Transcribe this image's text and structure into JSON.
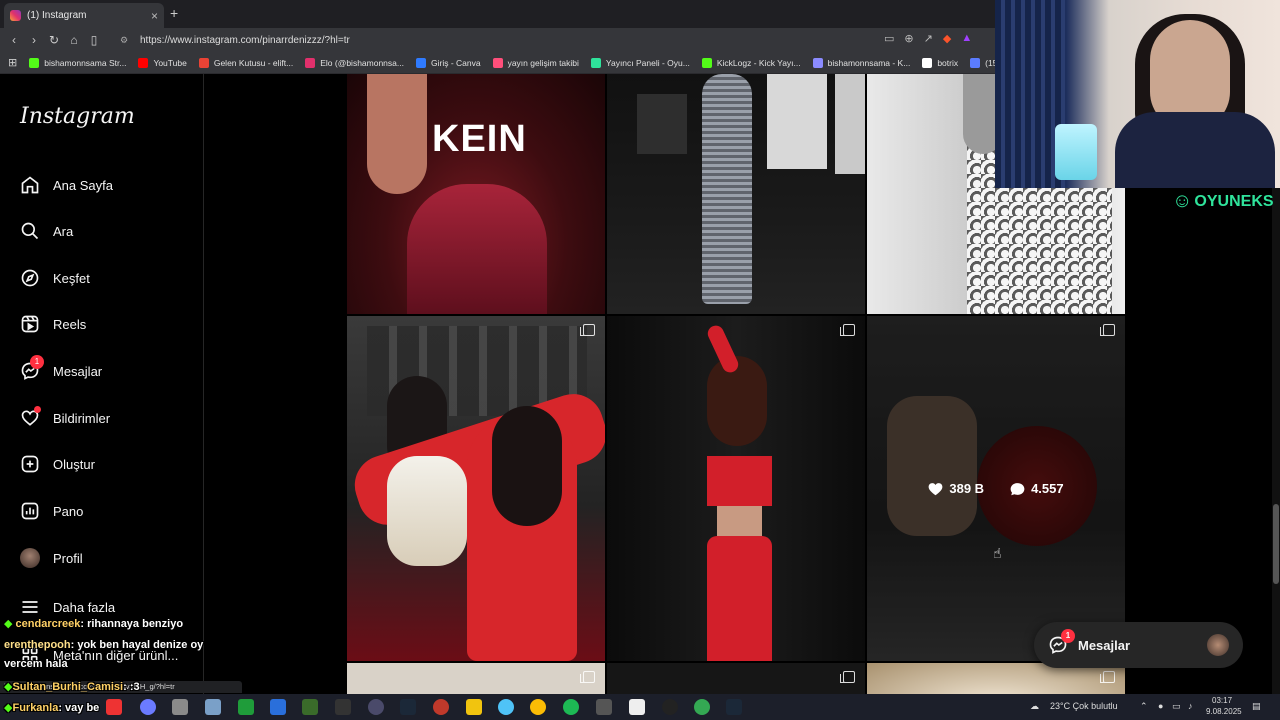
{
  "browser": {
    "tab_title": "(1) Instagram",
    "url": "https://www.instagram.com/pinarrdenizzz/?hl=tr",
    "bookmarks": [
      {
        "label": "bishamonnsama Str...",
        "color": "#53fc18"
      },
      {
        "label": "YouTube",
        "color": "#ff0000"
      },
      {
        "label": "Gelen Kutusu - elift...",
        "color": "#ea4335"
      },
      {
        "label": "Elo (@bishamonnsa...",
        "color": "#e1306c"
      },
      {
        "label": "Giriş - Canva",
        "color": "#2f7bff"
      },
      {
        "label": "yayın gelişim takibi",
        "color": "#ff4f7b"
      },
      {
        "label": "Yayıncı Paneli - Oyu...",
        "color": "#2fe39b"
      },
      {
        "label": "KickLogz - Kick Yayı...",
        "color": "#53fc18"
      },
      {
        "label": "bishamonnsama - K...",
        "color": "#8b8bff"
      },
      {
        "label": "botrix",
        "color": "#ffffff"
      },
      {
        "label": "(15) Dashboard /",
        "color": "#5b7cff"
      }
    ]
  },
  "sidebar": {
    "logo": "Instagram",
    "items": [
      {
        "label": "Ana Sayfa",
        "icon": "home-icon"
      },
      {
        "label": "Ara",
        "icon": "search-icon"
      },
      {
        "label": "Keşfet",
        "icon": "compass-icon"
      },
      {
        "label": "Reels",
        "icon": "reels-icon"
      },
      {
        "label": "Mesajlar",
        "icon": "messenger-icon",
        "badge": "1"
      },
      {
        "label": "Bildirimler",
        "icon": "heart-icon"
      },
      {
        "label": "Oluştur",
        "icon": "plus-square-icon"
      },
      {
        "label": "Pano",
        "icon": "dashboard-icon"
      },
      {
        "label": "Profil",
        "icon": "avatar"
      },
      {
        "label": "Daha fazla",
        "icon": "menu-icon"
      },
      {
        "label": "Meta'nın diğer ürünl...",
        "icon": "meta-icon"
      }
    ]
  },
  "feed": {
    "posts": [
      {
        "caption_text": "KEIN"
      },
      {},
      {},
      {},
      {},
      {
        "likes": "389 B",
        "comments": "4.557"
      }
    ]
  },
  "messages_pill": {
    "label": "Mesajlar",
    "badge": "1"
  },
  "overlay": {
    "brand": "OYUNEKS",
    "chat": [
      {
        "user": "cendarcreek",
        "text": ": rihannaya benziyo"
      },
      {
        "user": "erenthepooh",
        "text": ": yok ben hayal denize oy"
      },
      {
        "user": "",
        "text": "vercem hala"
      },
      {
        "user": "Sultan_Burhi_Camisi",
        "text": ": :3"
      },
      {
        "user": "Furkanla",
        "text": ": vay be"
      }
    ],
    "status_link": "https://www.instagram.com/p/C7bXSv3MH_g/?hl=tr"
  },
  "taskbar": {
    "weather": "23°C  Çok bulutlu",
    "time": "03:17",
    "date": "9.08.2025"
  }
}
